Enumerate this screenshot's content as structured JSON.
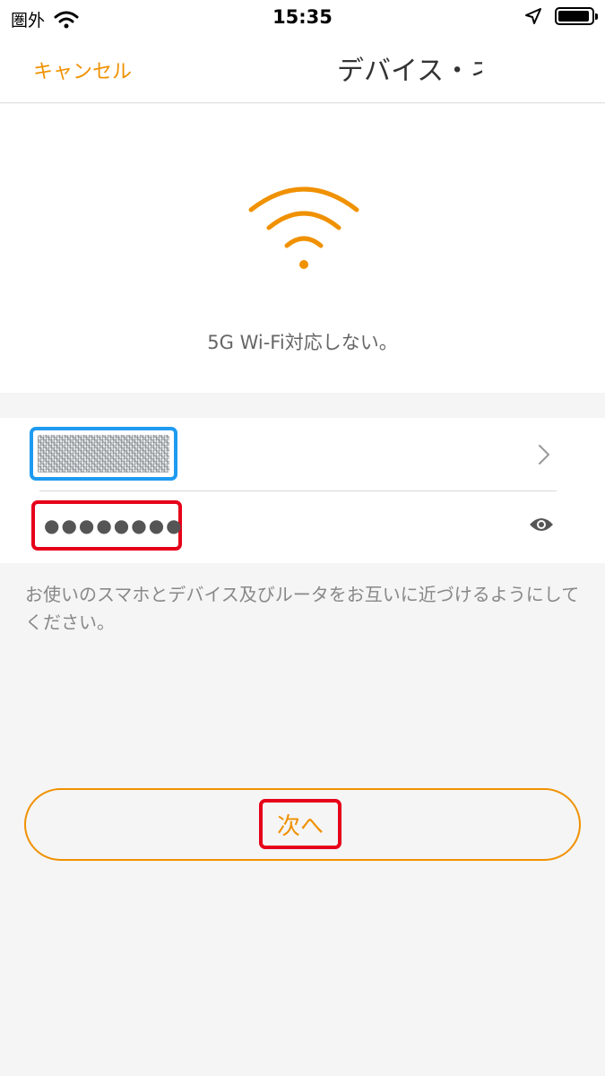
{
  "status_bar": {
    "carrier": "圏外",
    "time": "15:35",
    "battery_level": 0.95,
    "icons": [
      "wifi-icon",
      "location-arrow-icon",
      "battery-icon"
    ]
  },
  "nav": {
    "cancel_label": "キャンセル",
    "title": "デバイス・ネ"
  },
  "hero": {
    "icon": "wifi-icon",
    "message": "5G Wi-Fi対応しない。"
  },
  "form": {
    "ssid_value": "",
    "password_value": "●●●●●●●●",
    "icons": [
      "chevron-right-icon",
      "eye-icon"
    ]
  },
  "hint": "お使いのスマホとデバイス及びルータをお互いに近づけるようにしてください。",
  "next_button_label": "次へ",
  "colors": {
    "accent": "#f09100",
    "highlight_blue": "#1e9bf0",
    "highlight_red": "#e6001a",
    "background": "#f5f5f5"
  }
}
